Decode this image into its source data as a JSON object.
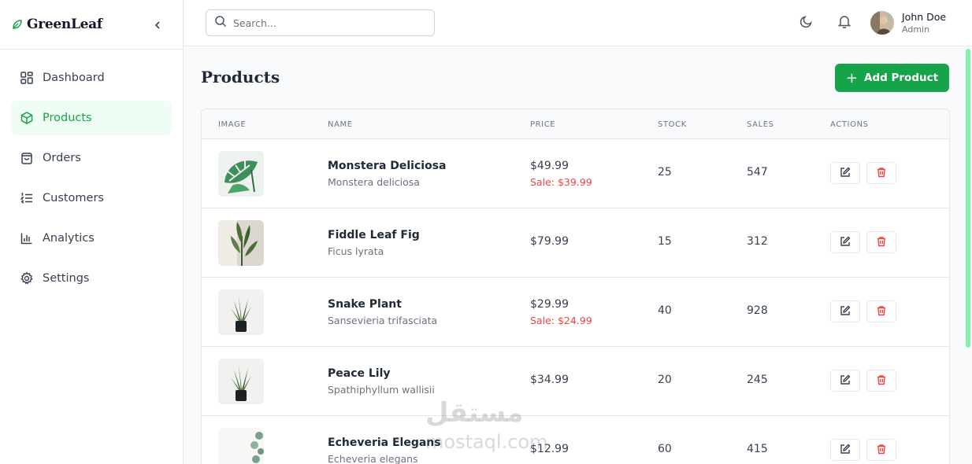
{
  "brand": {
    "name": "GreenLeaf",
    "icon": "leaf-icon"
  },
  "sidebar": {
    "items": [
      {
        "label": "Dashboard",
        "icon": "grid-icon",
        "active": false
      },
      {
        "label": "Products",
        "icon": "box-icon",
        "active": true
      },
      {
        "label": "Orders",
        "icon": "shopping-bag-icon",
        "active": false
      },
      {
        "label": "Customers",
        "icon": "list-icon",
        "active": false
      },
      {
        "label": "Analytics",
        "icon": "bar-chart-icon",
        "active": false
      },
      {
        "label": "Settings",
        "icon": "gear-icon",
        "active": false
      }
    ]
  },
  "topbar": {
    "search_placeholder": "Search...",
    "user": {
      "name": "John Doe",
      "role": "Admin"
    }
  },
  "main": {
    "title": "Products",
    "add_button": "Add Product",
    "columns": [
      "IMAGE",
      "NAME",
      "PRICE",
      "STOCK",
      "SALES",
      "ACTIONS"
    ],
    "rows": [
      {
        "name": "Monstera Deliciosa",
        "latin": "Monstera deliciosa",
        "price": "$49.99",
        "sale": "Sale: $39.99",
        "stock": "25",
        "sales": "547"
      },
      {
        "name": "Fiddle Leaf Fig",
        "latin": "Ficus lyrata",
        "price": "$79.99",
        "sale": "",
        "stock": "15",
        "sales": "312"
      },
      {
        "name": "Snake Plant",
        "latin": "Sansevieria trifasciata",
        "price": "$29.99",
        "sale": "Sale: $24.99",
        "stock": "40",
        "sales": "928"
      },
      {
        "name": "Peace Lily",
        "latin": "Spathiphyllum wallisii",
        "price": "$34.99",
        "sale": "",
        "stock": "20",
        "sales": "245"
      },
      {
        "name": "Echeveria Elegans",
        "latin": "Echeveria elegans",
        "price": "$12.99",
        "sale": "",
        "stock": "60",
        "sales": "415"
      }
    ]
  },
  "watermark": {
    "arabic": "مستقل",
    "latin": "mostaql.com"
  },
  "colors": {
    "accent": "#16a34a",
    "sale": "#ef4444",
    "active_bg": "#f0fdf4"
  }
}
